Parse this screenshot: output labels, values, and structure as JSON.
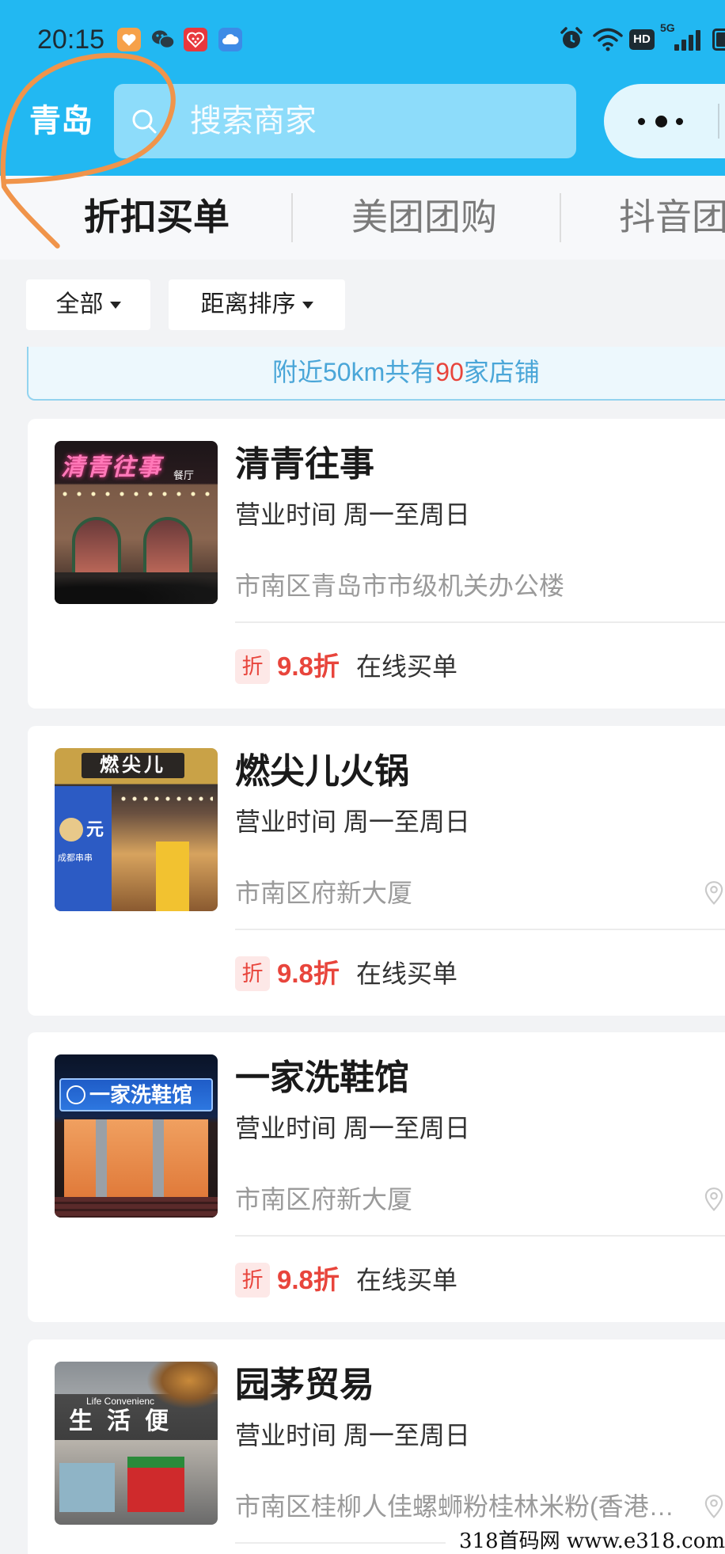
{
  "status_bar": {
    "time": "20:15",
    "left_icons": [
      "heart-app-icon",
      "wechat-icon",
      "red-app-icon",
      "cloud-app-icon"
    ],
    "right_icons": [
      "alarm-icon",
      "wifi-icon",
      "hd-icon",
      "signal-5g-icon",
      "battery-icon"
    ],
    "hd_label": "HD",
    "network_label": "5G"
  },
  "header": {
    "city": "青岛",
    "search_placeholder": "搜索商家",
    "more_icon": "more-dots-icon"
  },
  "tabs": [
    {
      "label": "折扣买单",
      "active": true
    },
    {
      "label": "美团团购",
      "active": false
    },
    {
      "label": "抖音团",
      "active": false
    }
  ],
  "filters": [
    {
      "label": "全部",
      "icon": "caret-down-icon"
    },
    {
      "label": "距离排序",
      "icon": "caret-down-icon"
    }
  ],
  "banner": {
    "prefix": "附近50km共有",
    "count": "90",
    "suffix": "家店铺"
  },
  "stores": [
    {
      "name": "清青往事",
      "hours": "营业时间 周一至周日",
      "address": "市南区青岛市市级机关办公楼",
      "badge": "折",
      "discount": "9.8折",
      "action": "在线买单",
      "show_pin": false,
      "photo_sign": "清青往事",
      "photo_sign_sub": "餐厅"
    },
    {
      "name": "燃尖儿火锅",
      "hours": "营业时间 周一至周日",
      "address": "市南区府新大厦",
      "badge": "折",
      "discount": "9.8折",
      "action": "在线买单",
      "show_pin": true,
      "photo_sign": "燃尖儿",
      "photo_poster_big": "元",
      "photo_poster": "成都串串"
    },
    {
      "name": "一家洗鞋馆",
      "hours": "营业时间 周一至周日",
      "address": "市南区府新大厦",
      "badge": "折",
      "discount": "9.8折",
      "action": "在线买单",
      "show_pin": true,
      "photo_sign": "一家洗鞋馆"
    },
    {
      "name": "园茅贸易",
      "hours": "营业时间 周一至周日",
      "address": "市南区桂柳人佳螺蛳粉桂林米粉(香港…",
      "show_pin": true,
      "photo_sign": "生活便",
      "photo_sign_en": "Life Convenienc"
    }
  ],
  "colors": {
    "header_bg": "#22b8f2",
    "accent_red": "#e8453c",
    "banner_text": "#4aa6d8",
    "annotation_stroke": "#f0944a"
  },
  "watermark": "318首码网 www.e318.com"
}
